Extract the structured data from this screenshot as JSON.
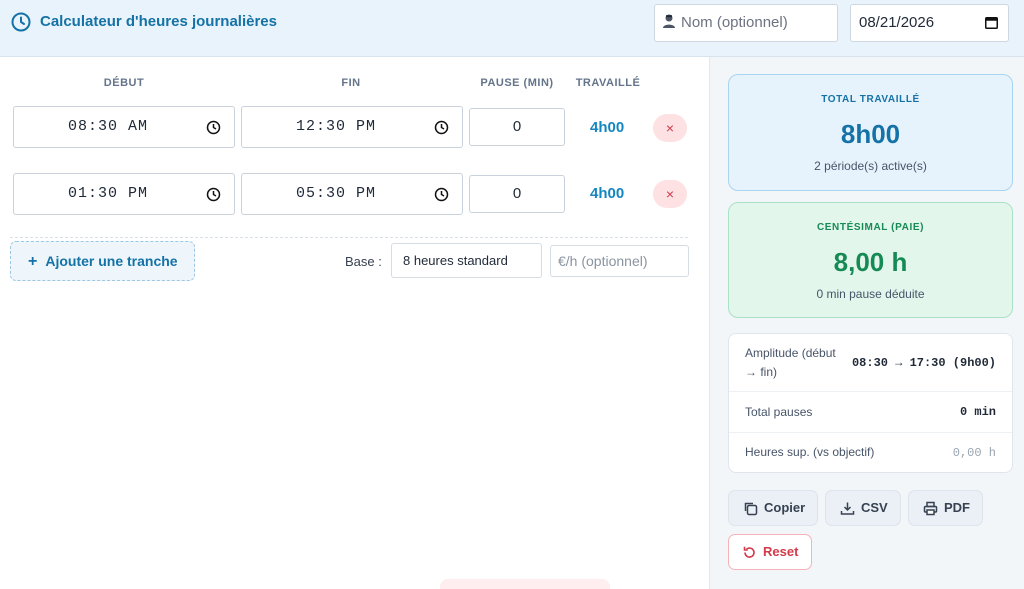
{
  "header": {
    "title": "Calculateur d'heures journalières",
    "name_placeholder": "Nom (optionnel)",
    "date_value": "08/21/2026"
  },
  "columns": {
    "start": "DÉBUT",
    "end": "FIN",
    "pause": "PAUSE (MIN)",
    "worked": "TRAVAILLÉ"
  },
  "rows": [
    {
      "start": "08:30 AM",
      "end": "12:30 PM",
      "pause": "0",
      "worked": "4h00",
      "delete": "×"
    },
    {
      "start": "01:30 PM",
      "end": "05:30 PM",
      "pause": "0",
      "worked": "4h00",
      "delete": "×"
    }
  ],
  "controls": {
    "add_label": "Ajouter une tranche",
    "add_plus": "+",
    "base_label": "Base :",
    "base_value": "8 heures standard",
    "rate_placeholder": "€/h (optionnel)"
  },
  "summary": {
    "total_label": "TOTAL TRAVAILLÉ",
    "total_value": "8h00",
    "total_sub": "2 période(s) active(s)",
    "cent_label": "CENTÉSIMAL (PAIE)",
    "cent_value": "8,00 h",
    "cent_sub": "0 min pause déduite"
  },
  "stats": [
    {
      "key": "Amplitude (début → fin)",
      "value": "08:30 → 17:30 (9h00)"
    },
    {
      "key": "Total pauses",
      "value": "0 min"
    },
    {
      "key": "Heures sup. (vs objectif)",
      "value": "0,00 h"
    }
  ],
  "actions": {
    "copy": "Copier",
    "csv": "CSV",
    "pdf": "PDF",
    "reset": "Reset"
  },
  "colors": {
    "accent": "#1572a6",
    "worked": "#1587c0",
    "success": "#168a55",
    "danger": "#d33a4a"
  },
  "icons": {
    "title": "clock-icon",
    "name": "user-icon",
    "date": "calendar-icon",
    "time": "clock-icon",
    "delete": "close-icon",
    "copy": "copy-icon",
    "csv": "download-icon",
    "pdf": "printer-icon",
    "reset": "reset-icon"
  }
}
